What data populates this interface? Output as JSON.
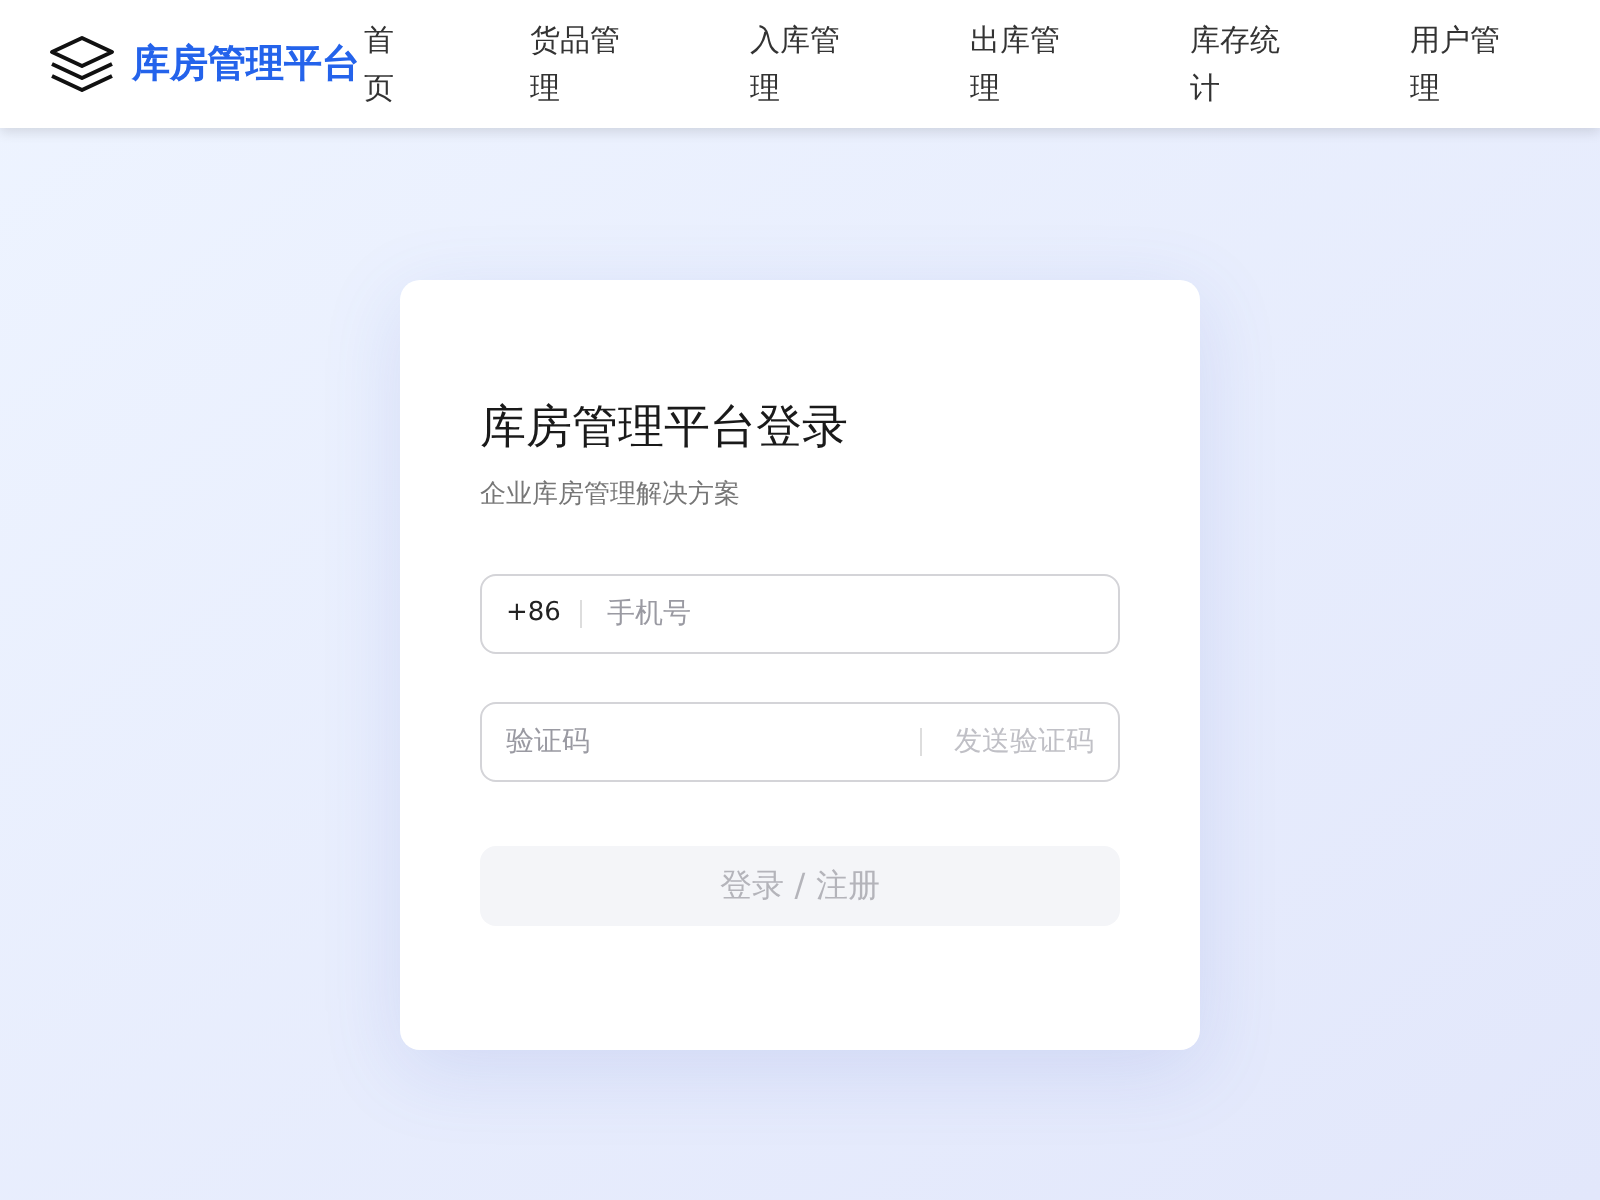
{
  "header": {
    "brand": "库房管理平台",
    "nav": [
      {
        "label": "首页"
      },
      {
        "label": "货品管理"
      },
      {
        "label": "入库管理"
      },
      {
        "label": "出库管理"
      },
      {
        "label": "库存统计"
      },
      {
        "label": "用户管理"
      }
    ]
  },
  "login": {
    "title": "库房管理平台登录",
    "subtitle": "企业库房管理解决方案",
    "phone": {
      "prefix": "+86",
      "placeholder": "手机号"
    },
    "code": {
      "placeholder": "验证码",
      "send_button": {
        "label": "发送验证码",
        "disabled": true
      }
    },
    "submit": {
      "label": "登录 / 注册",
      "disabled": true
    }
  }
}
